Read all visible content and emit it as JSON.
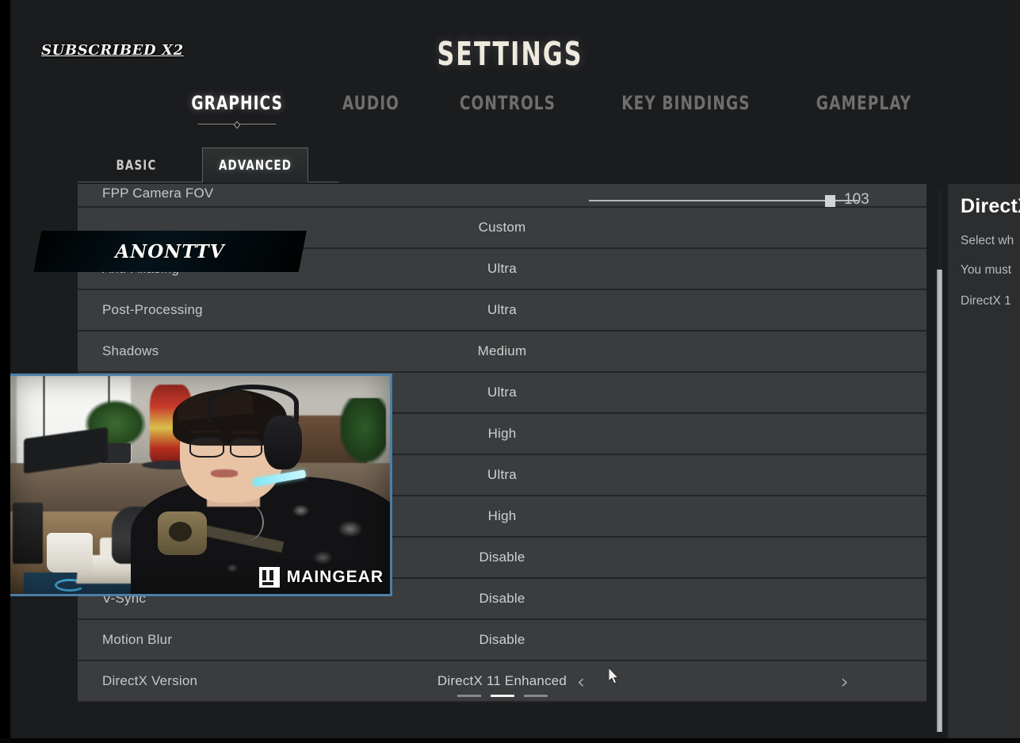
{
  "header": {
    "title": "SETTINGS",
    "tabs": [
      {
        "label": "GRAPHICS",
        "active": true
      },
      {
        "label": "AUDIO",
        "active": false
      },
      {
        "label": "CONTROLS",
        "active": false
      },
      {
        "label": "KEY BINDINGS",
        "active": false
      },
      {
        "label": "GAMEPLAY",
        "active": false
      }
    ]
  },
  "subtabs": [
    {
      "label": "BASIC",
      "active": false
    },
    {
      "label": "ADVANCED",
      "active": true
    }
  ],
  "settings": {
    "rows": [
      {
        "label": "FPP Camera FOV",
        "value": "103",
        "type": "slider",
        "clipped_top": true
      },
      {
        "label": "",
        "value": "Custom",
        "type": "value"
      },
      {
        "label": "Anti-Aliasing",
        "value": "Ultra",
        "type": "value"
      },
      {
        "label": "Post-Processing",
        "value": "Ultra",
        "type": "value"
      },
      {
        "label": "Shadows",
        "value": "Medium",
        "type": "value"
      },
      {
        "label": "",
        "value": "Ultra",
        "type": "value"
      },
      {
        "label": "",
        "value": "High",
        "type": "value"
      },
      {
        "label": "",
        "value": "Ultra",
        "type": "value"
      },
      {
        "label": "",
        "value": "High",
        "type": "value"
      },
      {
        "label": "",
        "value": "Disable",
        "type": "value"
      },
      {
        "label": "V-Sync",
        "value": "Disable",
        "type": "value"
      },
      {
        "label": "Motion Blur",
        "value": "Disable",
        "type": "value"
      },
      {
        "label": "DirectX Version",
        "value": "DirectX 11 Enhanced",
        "type": "stepper"
      }
    ],
    "stepper": {
      "prev_icon": "chevron-left-icon",
      "next_icon": "chevron-right-icon",
      "page_count": 3,
      "page_active": 2
    },
    "slider": {
      "value": "103",
      "fill_percent": 88
    }
  },
  "info_panel": {
    "title": "DirectX",
    "line1": "Select wh",
    "line2": "You must",
    "line3": "DirectX 1"
  },
  "stream_alert": {
    "username": "ANONTTV",
    "message": "SUBSCRIBED X2",
    "accent_color": "#56c6dd"
  },
  "webcam": {
    "watermark": "MAINGEAR",
    "watermark_icon": "maingear-logo-icon",
    "border_color": "#4b7fa8"
  },
  "colors": {
    "background": "#1b1c1e",
    "row": "#3a3c3e",
    "row_divider": "#232527",
    "text_primary": "#c6c7c8",
    "title": "#efeade",
    "accent_cyan": "#56c6dd"
  }
}
